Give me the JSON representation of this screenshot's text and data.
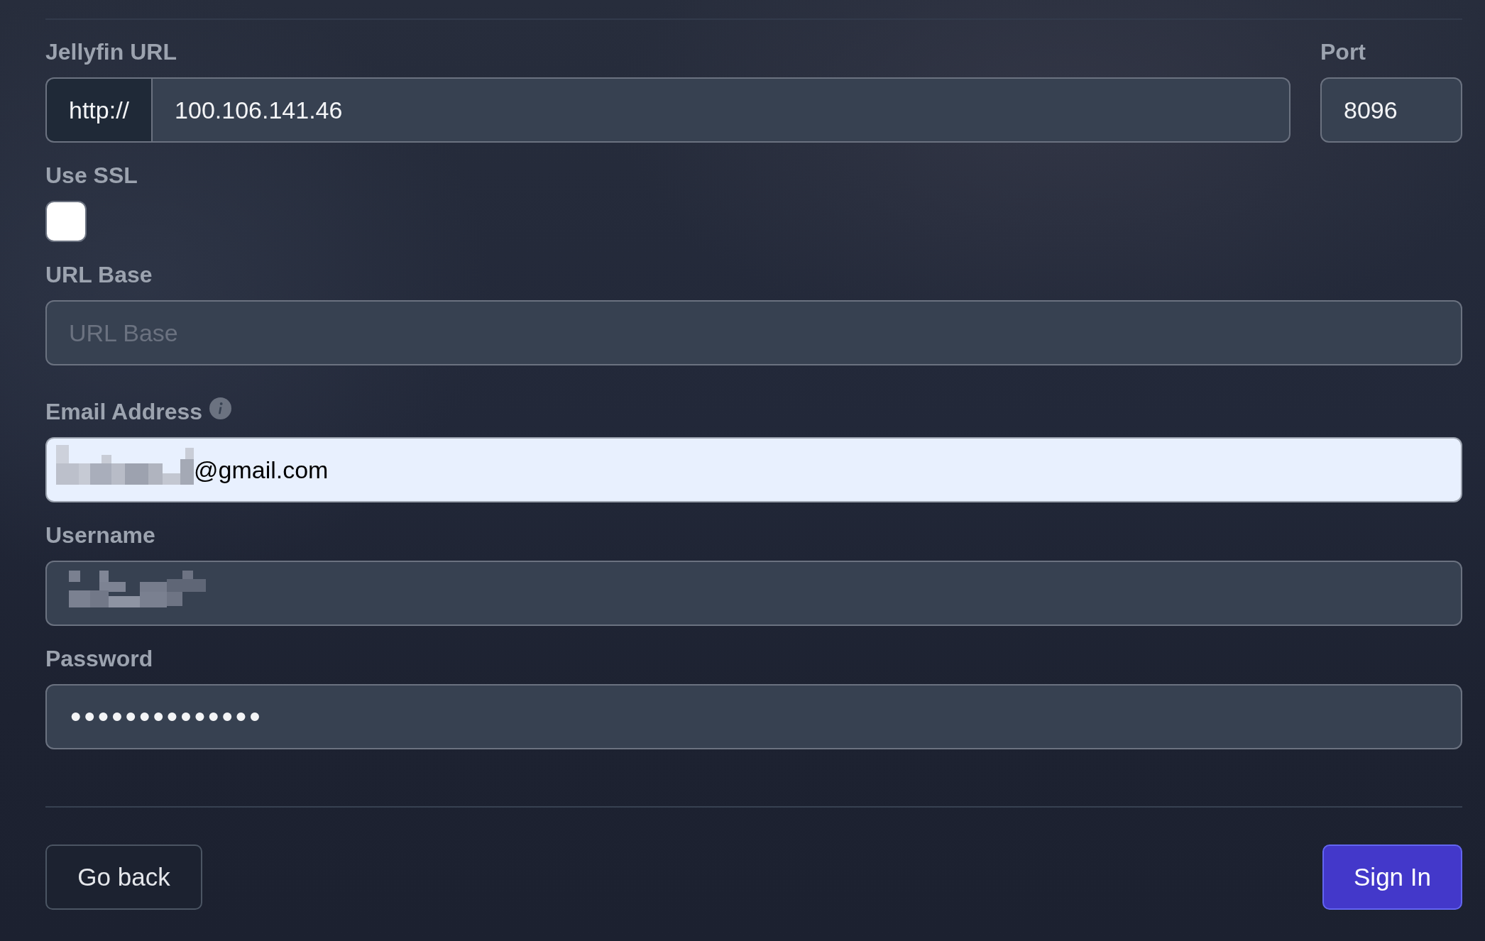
{
  "jellyfin_url": {
    "label": "Jellyfin URL",
    "prefix": "http://",
    "value": "100.106.141.46"
  },
  "port": {
    "label": "Port",
    "value": "8096"
  },
  "use_ssl": {
    "label": "Use SSL",
    "checked": false
  },
  "fields": [
    {
      "kind": "text",
      "label": "URL Base",
      "placeholder": "URL Base",
      "info": false,
      "redacted": false,
      "autofilled": false
    },
    {
      "kind": "text",
      "label": "Email Address",
      "value": "@gmail.com",
      "info": true,
      "redacted": true,
      "autofilled": true
    },
    {
      "kind": "text",
      "label": "Username",
      "info": false,
      "redacted": true,
      "autofilled": false
    },
    {
      "kind": "password",
      "label": "Password",
      "value": "••••••••••••••",
      "info": false,
      "redacted": false,
      "autofilled": false
    }
  ],
  "buttons": [
    {
      "kind": "secondary",
      "label": "Go back"
    },
    {
      "kind": "primary",
      "label": "Sign In"
    }
  ]
}
